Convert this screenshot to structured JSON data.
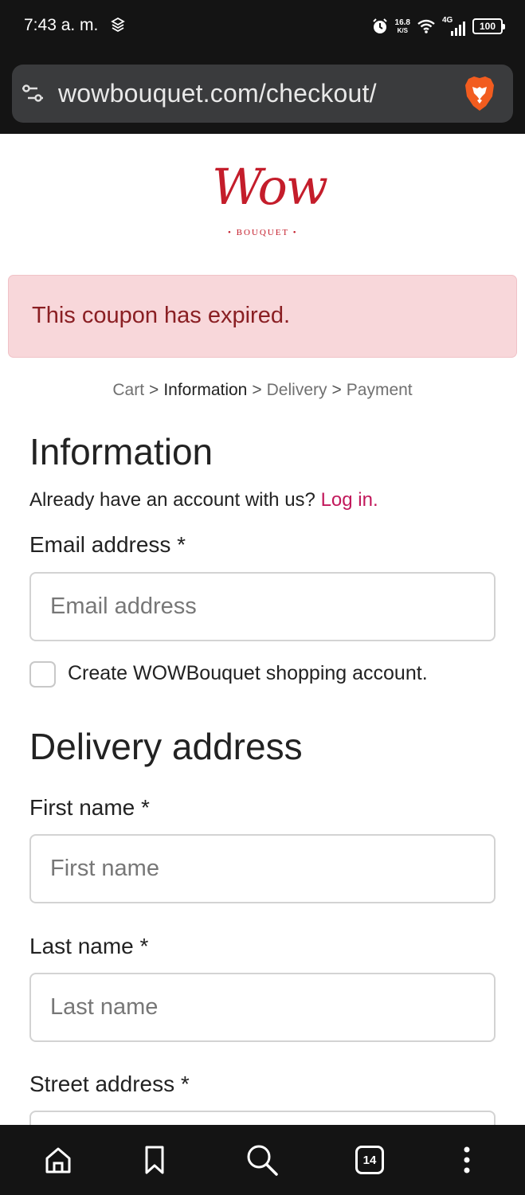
{
  "status_bar": {
    "time": "7:43 a. m.",
    "net_speed_value": "16.8",
    "net_speed_unit": "K/S",
    "network": "4G",
    "battery": "100"
  },
  "browser": {
    "url": "wowbouquet.com/checkout/",
    "tab_count": "14"
  },
  "logo": {
    "script": "Wow",
    "sub": "• BOUQUET •"
  },
  "alert": {
    "message": "This coupon has expired."
  },
  "breadcrumb": {
    "items": [
      "Cart",
      "Information",
      "Delivery",
      "Payment"
    ],
    "separator": ">"
  },
  "information": {
    "heading": "Information",
    "account_prompt": "Already have an account with us?",
    "login_link": "Log in.",
    "email_label": "Email address *",
    "email_placeholder": "Email address",
    "email_value": "",
    "create_account_label": "Create WOWBouquet shopping account.",
    "create_account_checked": false
  },
  "delivery": {
    "heading": "Delivery address",
    "first_name_label": "First name *",
    "first_name_placeholder": "First name",
    "last_name_label": "Last name *",
    "last_name_placeholder": "Last name",
    "street_label": "Street address *"
  },
  "colors": {
    "brand": "#c41d2b",
    "link": "#c2185b",
    "alert_bg": "#f8d7da",
    "alert_text": "#8a1f23"
  }
}
